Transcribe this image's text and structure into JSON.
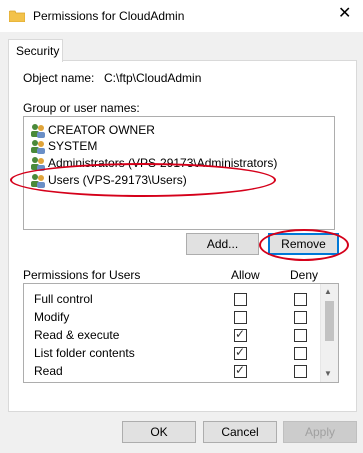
{
  "window": {
    "title": "Permissions for CloudAdmin",
    "close_glyph": "✕"
  },
  "tabs": [
    {
      "label": "Security"
    }
  ],
  "object": {
    "label": "Object name:",
    "value": "C:\\ftp\\CloudAdmin"
  },
  "groups": {
    "label": "Group or user names:",
    "items": [
      {
        "label": "CREATOR OWNER",
        "icon": "users-icon"
      },
      {
        "label": "SYSTEM",
        "icon": "users-icon"
      },
      {
        "label": "Administrators (VPS-29173\\Administrators)",
        "icon": "users-icon"
      },
      {
        "label": "Users (VPS-29173\\Users)",
        "icon": "users-icon",
        "selected": true
      }
    ]
  },
  "buttons": {
    "add": "Add...",
    "remove": "Remove",
    "ok": "OK",
    "cancel": "Cancel",
    "apply": "Apply"
  },
  "permissions": {
    "label": "Permissions for Users",
    "allow_header": "Allow",
    "deny_header": "Deny",
    "rows": [
      {
        "name": "Full control",
        "allow": false,
        "deny": false
      },
      {
        "name": "Modify",
        "allow": false,
        "deny": false
      },
      {
        "name": "Read & execute",
        "allow": true,
        "deny": false
      },
      {
        "name": "List folder contents",
        "allow": true,
        "deny": false
      },
      {
        "name": "Read",
        "allow": true,
        "deny": false
      }
    ]
  },
  "colors": {
    "annotation": "#d5001a",
    "focus": "#0078d7"
  }
}
